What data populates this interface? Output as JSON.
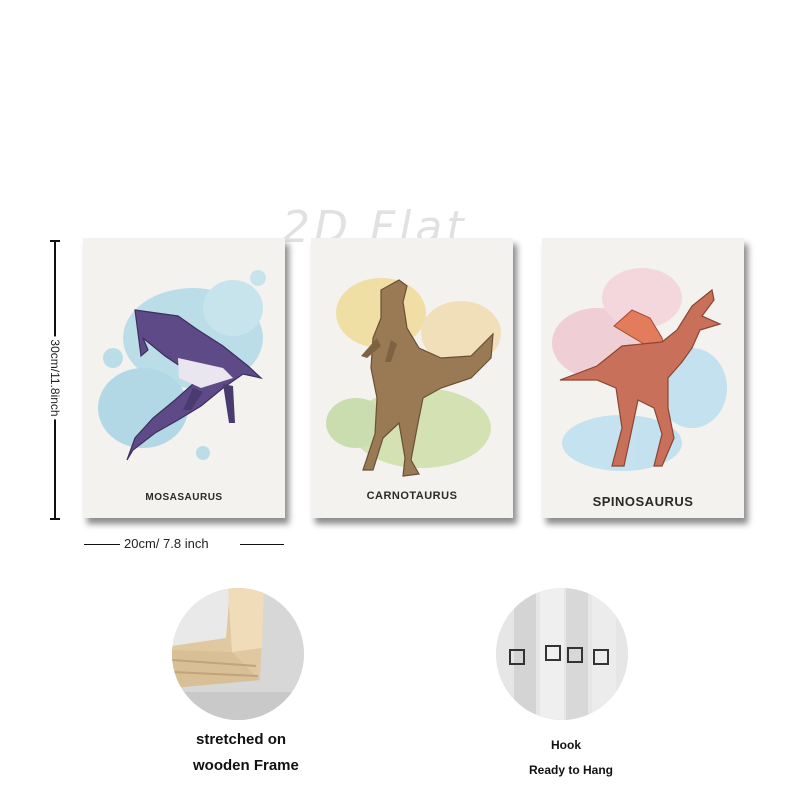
{
  "watermark": "2D Flat",
  "posters": [
    {
      "label": "MOSASAURUS",
      "accent": "#9fd3e3"
    },
    {
      "label": "CARNOTAURUS",
      "accent": "#e6d08c"
    },
    {
      "label": "SPINOSAURUS",
      "accent": "#f0b9c6"
    }
  ],
  "dimensions": {
    "height": "30cm/11.8inch",
    "width": "20cm/ 7.8 inch"
  },
  "features": [
    {
      "line1": "stretched on",
      "line2": "wooden Frame"
    },
    {
      "line1": "Hook",
      "line2": "Ready to Hang"
    }
  ]
}
